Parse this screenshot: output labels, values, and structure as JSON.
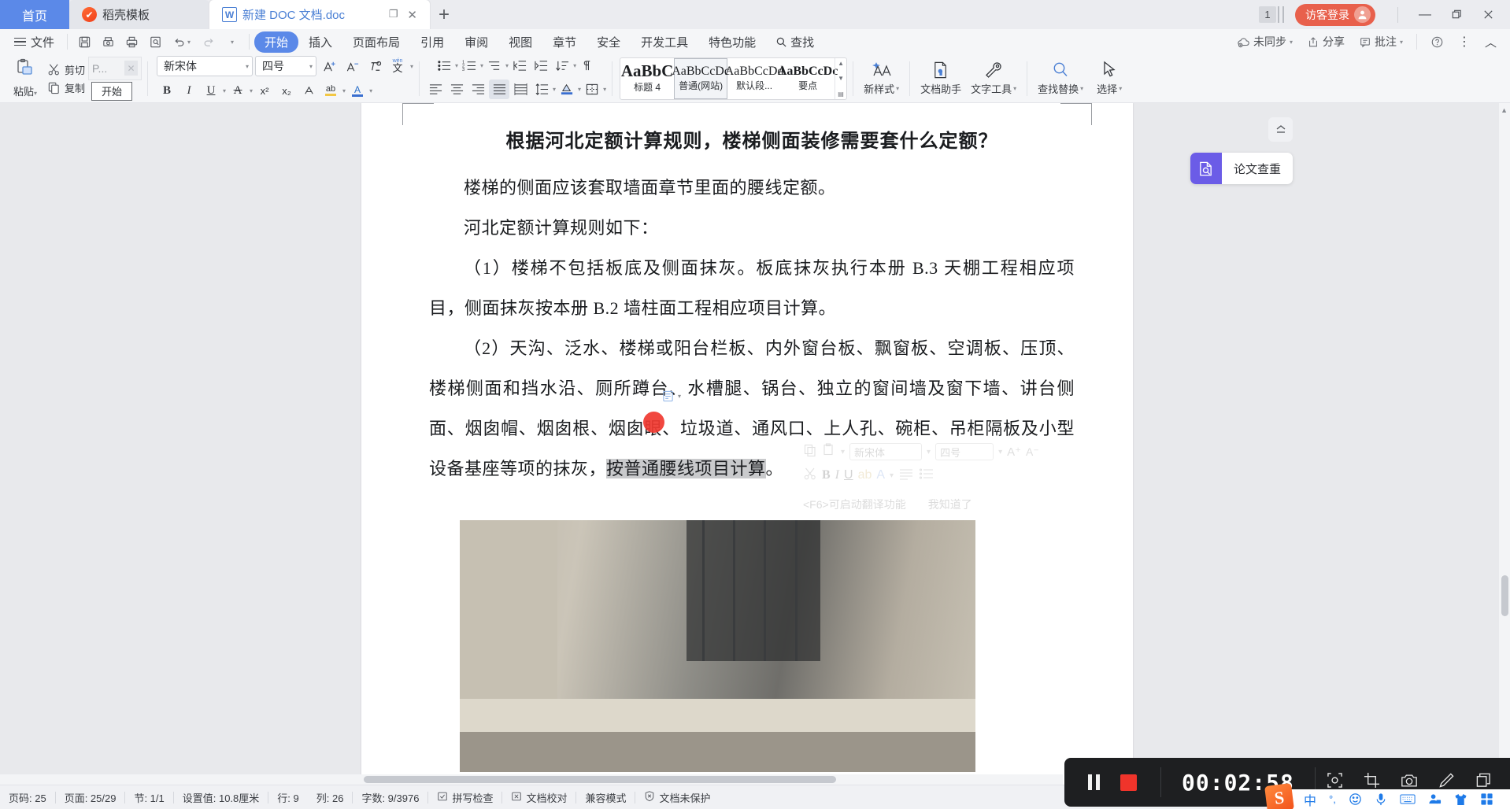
{
  "tabbar": {
    "tabs": [
      {
        "label": "首页",
        "icon": ""
      },
      {
        "label": "稻壳模板",
        "icon": "daoke-icon"
      },
      {
        "label": "新建 DOC 文档.doc",
        "icon": "word-icon"
      }
    ],
    "new_tab": "+",
    "restore_glyph": "❐",
    "close_glyph": "✕",
    "count_badge": "1",
    "login_label": "访客登录",
    "window_controls": {
      "minimize": "—",
      "maximize": "❐",
      "close": "✕"
    }
  },
  "ribbon_tabs": {
    "file_label": "文件",
    "quick_access": [
      "save-icon",
      "print-preview-icon",
      "print-icon",
      "search-doc-icon",
      "undo-icon",
      "redo-icon",
      "customize-icon"
    ],
    "tabs": [
      {
        "label": "开始",
        "active": true
      },
      {
        "label": "插入",
        "active": false
      },
      {
        "label": "页面布局",
        "active": false
      },
      {
        "label": "引用",
        "active": false
      },
      {
        "label": "审阅",
        "active": false
      },
      {
        "label": "视图",
        "active": false
      },
      {
        "label": "章节",
        "active": false
      },
      {
        "label": "安全",
        "active": false
      },
      {
        "label": "开发工具",
        "active": false
      },
      {
        "label": "特色功能",
        "active": false
      }
    ],
    "find_label": "查找",
    "right_items": [
      {
        "label": "未同步",
        "icon": "cloud-sync-icon",
        "caret": "▾"
      },
      {
        "label": "分享",
        "icon": "share-icon",
        "caret": ""
      },
      {
        "label": "批注",
        "icon": "comment-icon",
        "caret": "▾"
      }
    ],
    "help_glyph": "?",
    "more_glyph": "⋮",
    "collapse_glyph": "︿"
  },
  "ribbon": {
    "paste": {
      "label": "粘贴",
      "caret": "▾",
      "icon": "clipboard-icon"
    },
    "cut": {
      "label": "剪切",
      "icon": "scissors-icon"
    },
    "copy": {
      "label": "复制",
      "icon": "copy-icon"
    },
    "format_painter_input": {
      "value": "P...",
      "close": "✕"
    },
    "start_box_value": "开始",
    "font_name": {
      "value": "新宋体",
      "caret": "▾"
    },
    "font_size": {
      "value": "四号",
      "caret": "▾"
    },
    "font_buttons": [
      {
        "name": "grow-font-icon",
        "glyph": "A⁺"
      },
      {
        "name": "shrink-font-icon",
        "glyph": "A⁻"
      },
      {
        "name": "clear-format-icon",
        "glyph": "◌"
      },
      {
        "name": "pinyin-guide-icon",
        "glyph": "文"
      }
    ],
    "font_buttons2": [
      {
        "name": "bold-icon",
        "glyph": "B"
      },
      {
        "name": "italic-icon",
        "glyph": "I"
      },
      {
        "name": "underline-icon",
        "glyph": "U"
      },
      {
        "name": "strikethrough-icon",
        "glyph": "A"
      },
      {
        "name": "superscript-icon",
        "glyph": "x²"
      },
      {
        "name": "subscript-icon",
        "glyph": "x₂"
      },
      {
        "name": "char-border-icon",
        "glyph": "A"
      },
      {
        "name": "highlight-icon",
        "glyph": "ab"
      },
      {
        "name": "font-color-icon",
        "glyph": "A"
      },
      {
        "name": "char-shading-icon",
        "glyph": "A"
      }
    ],
    "para_row1": [
      "bullets-icon",
      "numbering-icon",
      "multilevel-list-icon",
      "decrease-indent-icon",
      "increase-indent-icon",
      "sort-icon",
      "show-marks-icon"
    ],
    "para_row2": [
      "align-left-icon",
      "align-center-icon",
      "align-right-icon",
      "justify-icon",
      "distributed-icon",
      "line-spacing-icon",
      "shading-icon",
      "borders-icon"
    ],
    "styles": [
      {
        "preview": "AaBbC",
        "name": "标题 4",
        "selected": false,
        "weight": "bold",
        "size": "21px"
      },
      {
        "preview": "AaBbCcDс",
        "name": "普通(网站)",
        "selected": true,
        "weight": "normal",
        "size": "16px"
      },
      {
        "preview": "AaBbCcDd",
        "name": "默认段...",
        "selected": false,
        "weight": "normal",
        "size": "16px"
      },
      {
        "preview": "AaBbCcDс",
        "name": "要点",
        "selected": false,
        "weight": "bold",
        "size": "16px"
      }
    ],
    "gallery_scroll": {
      "up": "▲",
      "down": "▼",
      "more": "▤"
    },
    "tools": [
      {
        "label": "新样式",
        "caret": "▾",
        "icon": "new-style-icon"
      },
      {
        "label": "文档助手",
        "caret": "",
        "icon": "doc-assistant-icon"
      },
      {
        "label": "文字工具",
        "caret": "▾",
        "icon": "text-tools-icon"
      },
      {
        "label": "查找替换",
        "caret": "▾",
        "icon": "find-replace-icon"
      },
      {
        "label": "选择",
        "caret": "▾",
        "icon": "select-icon"
      }
    ]
  },
  "document": {
    "heading": "根据河北定额计算规则，楼梯侧面装修需要套什么定额？",
    "paragraphs": [
      {
        "text": "楼梯的侧面应该套取墙面章节里面的腰线定额。"
      },
      {
        "text": "河北定额计算规则如下："
      },
      {
        "text": "（1）楼梯不包括板底及侧面抹灰。板底抹灰执行本册 B.3 天棚工程相应项目，侧面抹灰按本册 B.2 墙柱面工程相应项目计算。"
      }
    ],
    "long_paragraph_prefix": "（2）天沟、泛水、楼梯或阳台栏板、内外窗台板、飘窗板、空调板、压顶、楼梯侧面和挡水沿、厕所蹲台、水槽腿、锅台、独立的窗间墙及窗下墙、讲台侧面、烟囱帽、烟囱根、烟囱眼、垃圾道、通风口、上人孔、碗柜、吊柜隔板及小型设备基座等项的抹灰，",
    "highlighted_text": "按普通腰线项目计算",
    "long_paragraph_suffix": "。",
    "image_alt": "楼梯侧面照片"
  },
  "ghost_toolbar": {
    "font_name": "新宋体",
    "font_size": "四号",
    "tip": "<F6>可启动翻译功能",
    "dismiss": "我知道了"
  },
  "right_panel": {
    "collapse_icon": "collapse-panel-icon",
    "card_label": "论文查重",
    "card_icon": "paper-check-icon",
    "accent": "#6b5ce7"
  },
  "statusbar": {
    "items": [
      {
        "label": "页码: 25",
        "icon": ""
      },
      {
        "label": "页面: 25/29",
        "icon": ""
      },
      {
        "label": "节: 1/1",
        "icon": ""
      },
      {
        "label": "设置值: 10.8厘米",
        "icon": ""
      },
      {
        "label": "行: 9",
        "icon": ""
      },
      {
        "label": "列: 26",
        "icon": ""
      },
      {
        "label": "字数: 9/3976",
        "icon": ""
      },
      {
        "label": "拼写检查",
        "icon": "spellcheck-icon"
      },
      {
        "label": "文档校对",
        "icon": "proofread-icon"
      },
      {
        "label": "兼容模式",
        "icon": ""
      },
      {
        "label": "文档未保护",
        "icon": "shield-icon"
      }
    ],
    "resize_glyph": "⤡"
  },
  "recorder": {
    "pause_icon": "pause-icon",
    "stop_icon": "stop-icon",
    "time": "00:02:58",
    "tools": [
      "region-select-icon",
      "crop-icon",
      "camera-icon",
      "pen-icon",
      "window-icon"
    ]
  },
  "ime": {
    "logo": "S",
    "items": [
      {
        "icon": "chinese-mode-icon",
        "glyph": "中"
      },
      {
        "icon": "punctuation-icon",
        "glyph": "°,"
      },
      {
        "icon": "emoji-icon",
        "glyph": "☺"
      },
      {
        "icon": "voice-input-icon",
        "glyph": "🎤"
      },
      {
        "icon": "soft-keyboard-icon",
        "glyph": "⌨"
      },
      {
        "icon": "user-icon",
        "glyph": "👤"
      },
      {
        "icon": "skin-icon",
        "glyph": "👕"
      },
      {
        "icon": "toolbox-icon",
        "glyph": "▦"
      }
    ]
  },
  "colors": {
    "tab_active_blue": "#5b89e8",
    "login_red": "#e8604c",
    "panel_purple": "#6b5ce7",
    "recorder_bg": "#1e1f21",
    "stop_red": "#f0342b",
    "cursor_red": "#f03a32"
  }
}
